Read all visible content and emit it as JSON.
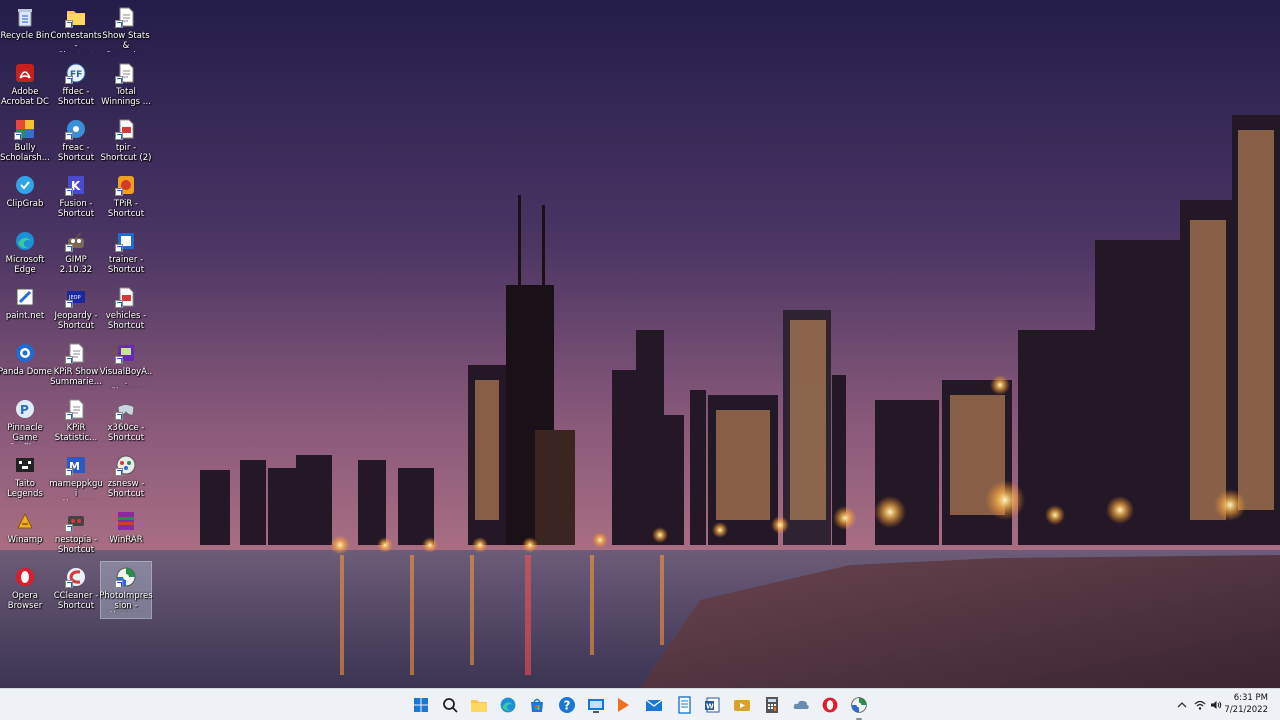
{
  "desktop": {
    "icons": [
      {
        "label": "Recycle Bin",
        "icon": "recycle-bin-icon",
        "shortcut": false,
        "selected": false
      },
      {
        "label": "Contestants -\nShortcut",
        "icon": "folder-icon",
        "shortcut": true,
        "selected": false
      },
      {
        "label": "Show Stats &\nRecords - S...",
        "icon": "document-icon",
        "shortcut": true,
        "selected": false
      },
      {
        "label": "Adobe\nAcrobat DC",
        "icon": "acrobat-icon",
        "shortcut": false,
        "selected": false
      },
      {
        "label": "ffdec -\nShortcut",
        "icon": "ffdec-icon",
        "shortcut": true,
        "selected": false
      },
      {
        "label": "Total\nWinnings ...",
        "icon": "document-icon",
        "shortcut": true,
        "selected": false
      },
      {
        "label": "Bully\nScholarsh...",
        "icon": "bully-icon",
        "shortcut": true,
        "selected": false
      },
      {
        "label": "freac -\nShortcut",
        "icon": "freac-icon",
        "shortcut": true,
        "selected": false
      },
      {
        "label": "tpir -\nShortcut (2)",
        "icon": "pdf-document-icon",
        "shortcut": true,
        "selected": false
      },
      {
        "label": "ClipGrab",
        "icon": "clipgrab-icon",
        "shortcut": false,
        "selected": false
      },
      {
        "label": "Fusion -\nShortcut",
        "icon": "fusion-icon",
        "shortcut": true,
        "selected": false
      },
      {
        "label": "TPiR -\nShortcut",
        "icon": "tpir-icon",
        "shortcut": true,
        "selected": false
      },
      {
        "label": "Microsoft\nEdge",
        "icon": "edge-icon",
        "shortcut": false,
        "selected": false
      },
      {
        "label": "GIMP 2.10.32",
        "icon": "gimp-icon",
        "shortcut": true,
        "selected": false
      },
      {
        "label": "trainer -\nShortcut",
        "icon": "trainer-icon",
        "shortcut": true,
        "selected": false
      },
      {
        "label": "paint.net",
        "icon": "paintnet-icon",
        "shortcut": false,
        "selected": false
      },
      {
        "label": "Jeopardy -\nShortcut",
        "icon": "jeopardy-icon",
        "shortcut": true,
        "selected": false
      },
      {
        "label": "vehicles -\nShortcut",
        "icon": "pdf-document-icon",
        "shortcut": true,
        "selected": false
      },
      {
        "label": "Panda Dome",
        "icon": "panda-dome-icon",
        "shortcut": false,
        "selected": false
      },
      {
        "label": "KPiR Show\nSummarie...",
        "icon": "document-icon",
        "shortcut": true,
        "selected": false
      },
      {
        "label": "VisualBoyA...\n- Shortcut",
        "icon": "visualboy-icon",
        "shortcut": true,
        "selected": false
      },
      {
        "label": "Pinnacle\nGame Profiler",
        "icon": "pinnacle-icon",
        "shortcut": false,
        "selected": false
      },
      {
        "label": "KPiR\nStatistic...",
        "icon": "document-icon",
        "shortcut": true,
        "selected": false
      },
      {
        "label": "x360ce -\nShortcut",
        "icon": "gamepad-icon",
        "shortcut": true,
        "selected": false
      },
      {
        "label": "Taito Legends",
        "icon": "taito-icon",
        "shortcut": false,
        "selected": false
      },
      {
        "label": "mameppkgui\n- Shortcut",
        "icon": "mame-icon",
        "shortcut": true,
        "selected": false
      },
      {
        "label": "zsnesw -\nShortcut",
        "icon": "zsnes-icon",
        "shortcut": true,
        "selected": false
      },
      {
        "label": "Winamp",
        "icon": "winamp-icon",
        "shortcut": false,
        "selected": false
      },
      {
        "label": "nestopia -\nShortcut",
        "icon": "nestopia-icon",
        "shortcut": true,
        "selected": false
      },
      {
        "label": "WinRAR",
        "icon": "winrar-icon",
        "shortcut": false,
        "selected": false
      },
      {
        "label": "Opera\nBrowser",
        "icon": "opera-icon",
        "shortcut": false,
        "selected": false
      },
      {
        "label": "CCleaner -\nShortcut",
        "icon": "ccleaner-icon",
        "shortcut": true,
        "selected": false
      },
      {
        "label": "PhotoImpres\nsion -\nShortcut",
        "icon": "photoimpression-icon",
        "shortcut": true,
        "selected": true
      }
    ]
  },
  "taskbar": {
    "apps": [
      {
        "icon": "windows-start-icon",
        "active": false
      },
      {
        "icon": "search-icon",
        "active": false
      },
      {
        "icon": "file-explorer-icon",
        "active": false
      },
      {
        "icon": "edge-icon",
        "active": false
      },
      {
        "icon": "microsoft-store-icon",
        "active": false
      },
      {
        "icon": "help-icon",
        "active": false
      },
      {
        "icon": "remote-desktop-icon",
        "active": false
      },
      {
        "icon": "media-player-icon",
        "active": false
      },
      {
        "icon": "mail-icon",
        "active": false
      },
      {
        "icon": "notepad-icon",
        "active": false
      },
      {
        "icon": "word-document-icon",
        "active": false
      },
      {
        "icon": "video-player-icon",
        "active": false
      },
      {
        "icon": "calculator-icon",
        "active": false
      },
      {
        "icon": "cloud-app-icon",
        "active": false
      },
      {
        "icon": "opera-icon",
        "active": false
      },
      {
        "icon": "photoimpression-icon",
        "active": true
      }
    ],
    "tray": {
      "chevron": "chevron-up-icon",
      "wifi": "wifi-icon",
      "volume": "volume-icon"
    },
    "clock": {
      "time": "6:31 PM",
      "date": "7/21/2022"
    }
  }
}
